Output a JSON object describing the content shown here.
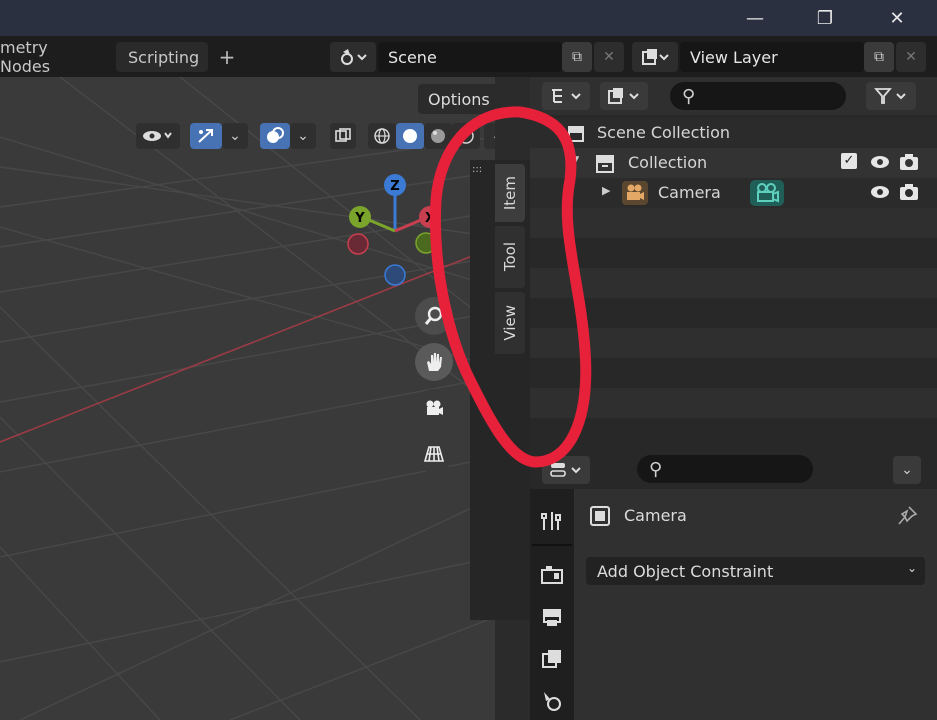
{
  "window": {
    "minimize": "—",
    "restore": "❐",
    "close": "✕"
  },
  "workspace_tabs": [
    "metry Nodes",
    "Scripting"
  ],
  "add_tab": "+",
  "scene": {
    "label": "Scene",
    "duplicate": "⧉",
    "close": "✕"
  },
  "view_layer": {
    "label": "View Layer",
    "duplicate": "⧉",
    "close": "✕"
  },
  "viewport": {
    "options_label": "Options",
    "chevron": "⌄",
    "gizmo_axes": {
      "z": "Z",
      "y": "Y",
      "x": "X"
    },
    "n_panel_tabs": [
      "Item",
      "Tool",
      "View"
    ]
  },
  "outliner": {
    "search_placeholder": "",
    "rows": [
      {
        "label": "Scene Collection"
      },
      {
        "label": "Collection"
      },
      {
        "label": "Camera"
      }
    ]
  },
  "properties": {
    "object_name": "Camera",
    "add_constraint_label": "Add Object Constraint",
    "search_placeholder": ""
  },
  "annotation": {
    "color": "#e8213a"
  }
}
